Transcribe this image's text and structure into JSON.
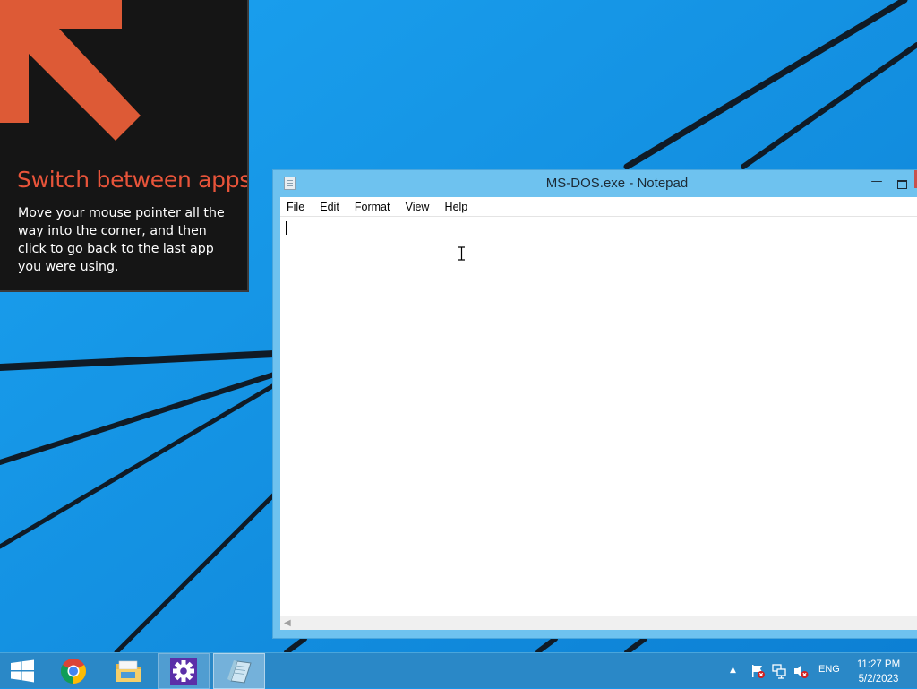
{
  "colors": {
    "desktop_bg": "#1593e6",
    "tip_bg": "#151515",
    "tip_accent": "#e8543a",
    "window_frame": "#6ec2ef",
    "taskbar": "#2a88c7",
    "close_button": "#c7504c"
  },
  "tip": {
    "title": "Switch between apps",
    "body": "Move your mouse pointer all the way into the corner, and then click to go back to the last app you were using.",
    "icon": "arrow-up-left-icon"
  },
  "notepad": {
    "title": "MS-DOS.exe - Notepad",
    "menu": [
      "File",
      "Edit",
      "Format",
      "View",
      "Help"
    ],
    "content": "",
    "icons": {
      "app": "notepad-icon",
      "minimize": "minimize-icon",
      "maximize": "maximize-icon",
      "close": "close-icon"
    }
  },
  "taskbar": {
    "buttons": [
      {
        "name": "start",
        "icon": "windows-logo-icon"
      },
      {
        "name": "chrome",
        "icon": "chrome-icon"
      },
      {
        "name": "file-explorer",
        "icon": "folder-icon"
      },
      {
        "name": "settings",
        "icon": "gear-icon"
      },
      {
        "name": "notepad",
        "icon": "notepad-icon",
        "active": true
      }
    ],
    "tray": {
      "show_hidden": "▲",
      "icons": [
        "action-center-flag-icon",
        "network-icon",
        "volume-muted-icon"
      ],
      "language": "ENG",
      "time": "11:27 PM",
      "date": "5/2/2023"
    }
  }
}
